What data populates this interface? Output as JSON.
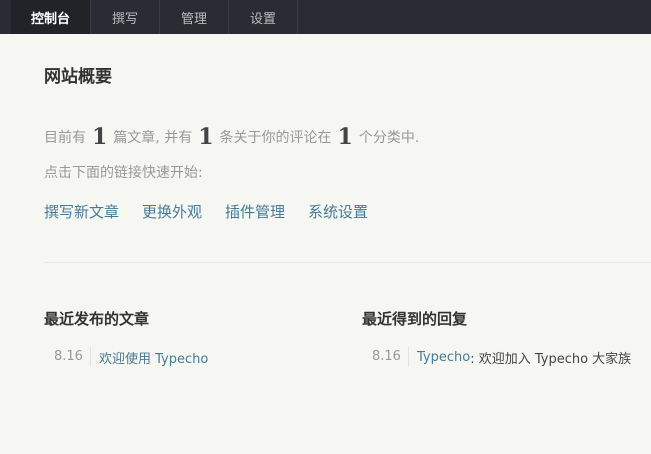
{
  "nav": [
    {
      "label": "控制台",
      "active": true
    },
    {
      "label": "撰写",
      "active": false
    },
    {
      "label": "管理",
      "active": false
    },
    {
      "label": "设置",
      "active": false
    }
  ],
  "overview": {
    "title": "网站概要",
    "summary_prefix": "目前有",
    "post_count": "1",
    "summary_mid1": "篇文章, 并有",
    "comment_count": "1",
    "summary_mid2": "条关于你的评论在",
    "category_count": "1",
    "summary_suffix": "个分类中.",
    "hint": "点击下面的链接快速开始:"
  },
  "quick_links": [
    "撰写新文章",
    "更换外观",
    "插件管理",
    "系统设置"
  ],
  "recent_posts": {
    "title": "最近发布的文章",
    "items": [
      {
        "date": "8.16",
        "title": "欢迎使用 Typecho"
      }
    ]
  },
  "recent_replies": {
    "title": "最近得到的回复",
    "items": [
      {
        "date": "8.16",
        "author": "Typecho",
        "text": ": 欢迎加入 Typecho 大家族"
      }
    ]
  },
  "colors": {
    "topbar": "#292d33",
    "link": "#467b96",
    "background": "#f6f6f3"
  }
}
